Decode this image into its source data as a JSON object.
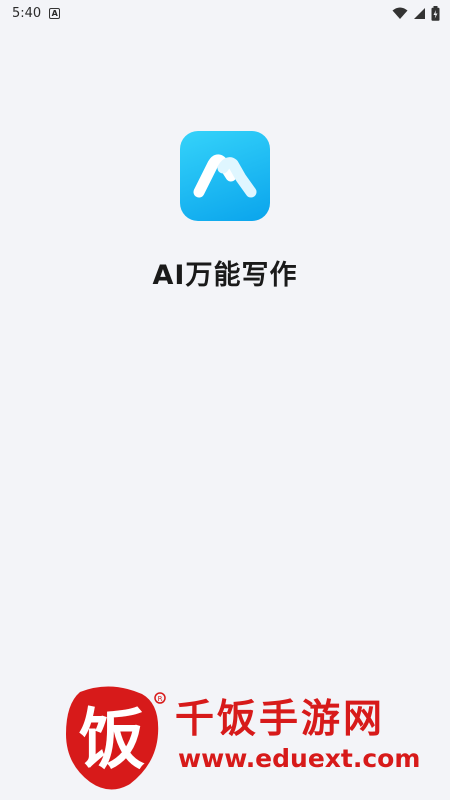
{
  "status_bar": {
    "time": "5:40",
    "notification_icon": "a-letter-icon",
    "wifi_icon": "wifi-icon",
    "signal_icon": "signal-icon",
    "battery_icon": "battery-charging-icon"
  },
  "splash": {
    "app_icon": "m-logo-icon",
    "app_name": "AI万能写作",
    "brand_colors": {
      "icon_gradient_start": "#35d3fa",
      "icon_gradient_end": "#0aa4ec"
    }
  },
  "watermark": {
    "site_name": "千饭手游网",
    "url": "www.eduext.com",
    "logo_char": "饭",
    "color": "#d71a1a"
  }
}
